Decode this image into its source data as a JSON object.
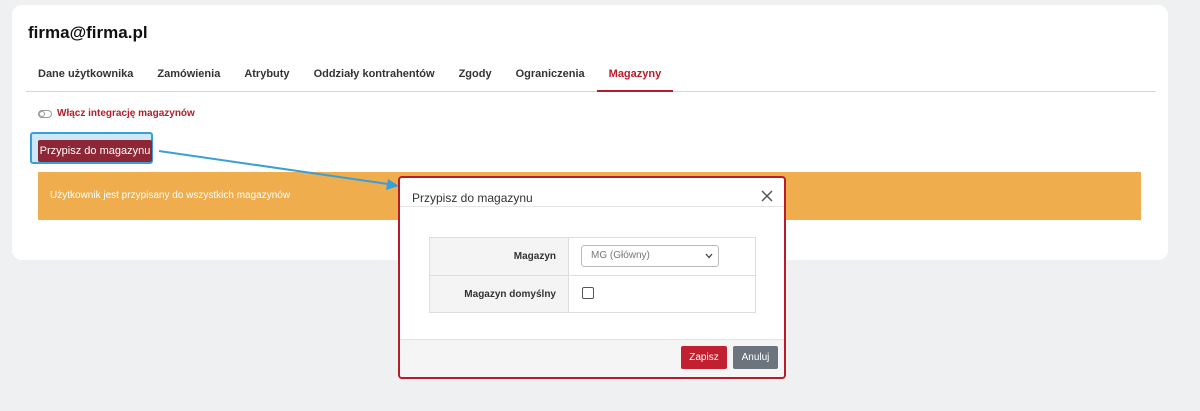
{
  "user": {
    "email": "firma@firma.pl"
  },
  "tabs": [
    {
      "label": "Dane użytkownika"
    },
    {
      "label": "Zamówienia"
    },
    {
      "label": "Atrybuty"
    },
    {
      "label": "Oddziały kontrahentów"
    },
    {
      "label": "Zgody"
    },
    {
      "label": "Ograniczenia"
    },
    {
      "label": "Magazyny"
    }
  ],
  "active_tab": "Magazyny",
  "integration_toggle": {
    "label": "Włącz integrację magazynów",
    "enabled": false
  },
  "assign_button": {
    "label": "Przypisz do magazynu"
  },
  "alert": {
    "text": "Użytkownik jest przypisany do wszystkich magazynów"
  },
  "modal": {
    "title": "Przypisz do magazynu",
    "fields": {
      "warehouse": {
        "label": "Magazyn",
        "value": "MG (Główny)"
      },
      "default_warehouse": {
        "label": "Magazyn domyślny",
        "checked": false
      }
    },
    "save_label": "Zapisz",
    "cancel_label": "Anuluj"
  },
  "colors": {
    "accent": "#b71c2b",
    "assign_button": "#8d2635",
    "alert": "#f0ad4e",
    "highlight": "#3a9fd8",
    "cancel": "#6c757d"
  },
  "icons": {
    "close": "close-icon",
    "select": "chevron-down-icon",
    "toggle": "toggle-switch-icon"
  }
}
